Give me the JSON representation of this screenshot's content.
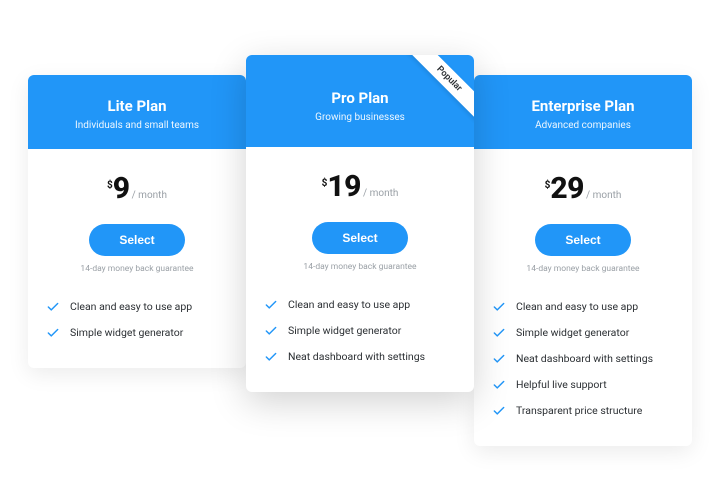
{
  "colors": {
    "primary": "#2196f8"
  },
  "common": {
    "currency": "$",
    "period": "/ month",
    "select_label": "Select",
    "guarantee": "14-day money back guarantee",
    "popular_badge": "Popular"
  },
  "feature_labels": [
    "Clean and easy to use app",
    "Simple widget generator",
    "Neat dashboard with settings",
    "Helpful live support",
    "Transparent price structure"
  ],
  "plans": [
    {
      "name": "Lite Plan",
      "subtitle": "Individuals and small teams",
      "price": "9",
      "feature_count": 2,
      "featured": false
    },
    {
      "name": "Pro Plan",
      "subtitle": "Growing businesses",
      "price": "19",
      "feature_count": 3,
      "featured": true
    },
    {
      "name": "Enterprise Plan",
      "subtitle": "Advanced companies",
      "price": "29",
      "feature_count": 5,
      "featured": false
    }
  ]
}
